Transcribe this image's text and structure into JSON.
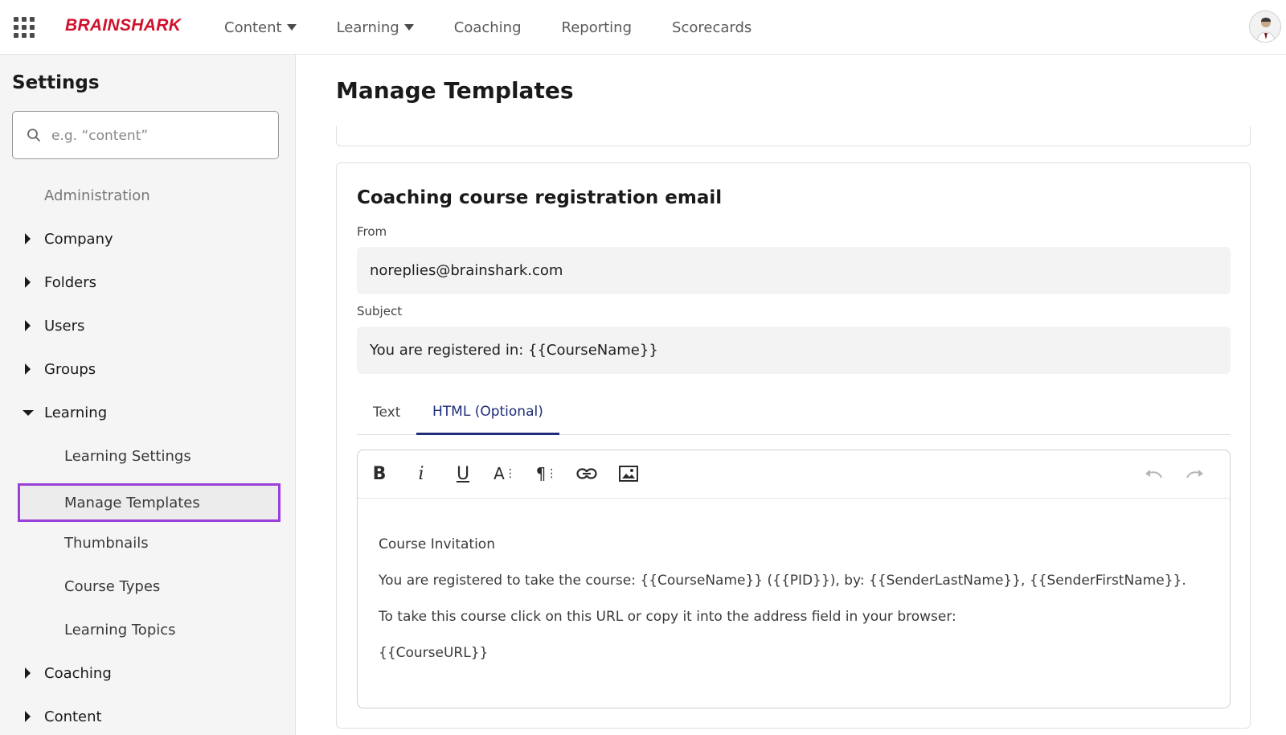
{
  "header": {
    "logo": "BRAINSHARK",
    "nav": [
      {
        "label": "Content",
        "has_dropdown": true
      },
      {
        "label": "Learning",
        "has_dropdown": true
      },
      {
        "label": "Coaching",
        "has_dropdown": false
      },
      {
        "label": "Reporting",
        "has_dropdown": false
      },
      {
        "label": "Scorecards",
        "has_dropdown": false
      }
    ]
  },
  "sidebar": {
    "title": "Settings",
    "search_placeholder": "e.g. “content”",
    "items": [
      {
        "label": "Administration"
      },
      {
        "label": "Company"
      },
      {
        "label": "Folders"
      },
      {
        "label": "Users"
      },
      {
        "label": "Groups"
      },
      {
        "label": "Learning"
      },
      {
        "label": "Learning Settings"
      },
      {
        "label": "Manage Templates"
      },
      {
        "label": "Thumbnails"
      },
      {
        "label": "Course Types"
      },
      {
        "label": "Learning Topics"
      },
      {
        "label": "Coaching"
      },
      {
        "label": "Content"
      }
    ]
  },
  "main": {
    "title": "Manage Templates",
    "template": {
      "title": "Coaching course registration email",
      "from_label": "From",
      "from_value": "noreplies@brainshark.com",
      "subject_label": "Subject",
      "subject_value": "You are registered in: {{CourseName}}",
      "tabs": [
        "Text",
        "HTML (Optional)"
      ],
      "active_tab": "HTML (Optional)",
      "editor_lines": [
        "Course Invitation",
        "You are registered to take the course: {{CourseName}} ({{PID}}), by: {{SenderLastName}}, {{SenderFirstName}}.",
        "To take this course click on this URL or copy it into the address field in your browser:",
        "{{CourseURL}}"
      ]
    }
  },
  "colors": {
    "brand": "#d0112b",
    "active_tab": "#1f2d7a",
    "selected_outline": "#9b3fd9"
  }
}
